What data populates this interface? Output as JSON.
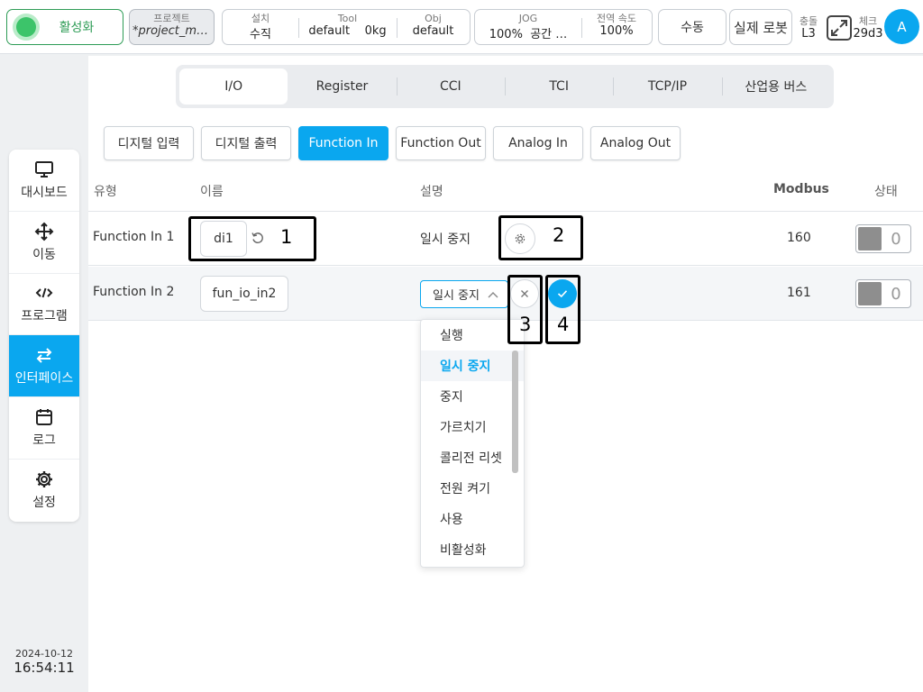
{
  "topbar": {
    "enable_label": "활성화",
    "project": {
      "label": "프로젝트",
      "value": "*project_mo…"
    },
    "install": {
      "label": "설치",
      "value": "수직"
    },
    "tool": {
      "label": "Tool",
      "name": "default",
      "weight": "0kg"
    },
    "obj": {
      "label": "Obj",
      "value": "default"
    },
    "jog": {
      "label": "JOG",
      "percent": "100%",
      "space": "공간 …"
    },
    "global_speed": {
      "label": "전역 속도",
      "value": "100%"
    },
    "mode_label": "수동",
    "robot_label": "실제 로봇",
    "collision": {
      "label": "충돌",
      "value": "L3"
    },
    "check": {
      "label": "체크",
      "value": "29d3"
    },
    "avatar_letter": "A"
  },
  "sidebar": {
    "items": [
      {
        "label": "대시보드",
        "icon": "monitor-icon"
      },
      {
        "label": "이동",
        "icon": "move-icon"
      },
      {
        "label": "프로그램",
        "icon": "code-icon"
      },
      {
        "label": "인터페이스",
        "icon": "swap-arrows-icon"
      },
      {
        "label": "로그",
        "icon": "calendar-icon"
      },
      {
        "label": "설정",
        "icon": "gear-icon"
      }
    ],
    "active_index": 3
  },
  "clock": {
    "date": "2024-10-12",
    "time": "16:54:11"
  },
  "tabs": [
    "I/O",
    "Register",
    "CCI",
    "TCI",
    "TCP/IP",
    "산업용 버스"
  ],
  "active_tab_index": 0,
  "subtabs": [
    "디지털 입력",
    "디지털 출력",
    "Function In",
    "Function Out",
    "Analog In",
    "Analog Out"
  ],
  "active_subtab_index": 2,
  "table": {
    "headers": {
      "type": "유형",
      "name": "이름",
      "desc": "설명",
      "modbus": "Modbus",
      "state": "상태"
    },
    "rows": [
      {
        "type": "Function In 1",
        "name": "di1",
        "desc": "일시 중지",
        "modbus": "160",
        "state": "0"
      },
      {
        "type": "Function In 2",
        "name": "fun_io_in2",
        "desc": "일시 중지",
        "modbus": "161",
        "state": "0"
      }
    ]
  },
  "dropdown": {
    "options": [
      "실행",
      "일시 중지",
      "중지",
      "가르치기",
      "콜리전 리셋",
      "전원 켜기",
      "사용",
      "비활성화"
    ],
    "selected_index": 1
  },
  "callouts": [
    "1",
    "2",
    "3",
    "4"
  ],
  "colors": {
    "accent": "#0aa7ef",
    "enable_green": "#3cc46a",
    "callout": "#000000"
  }
}
